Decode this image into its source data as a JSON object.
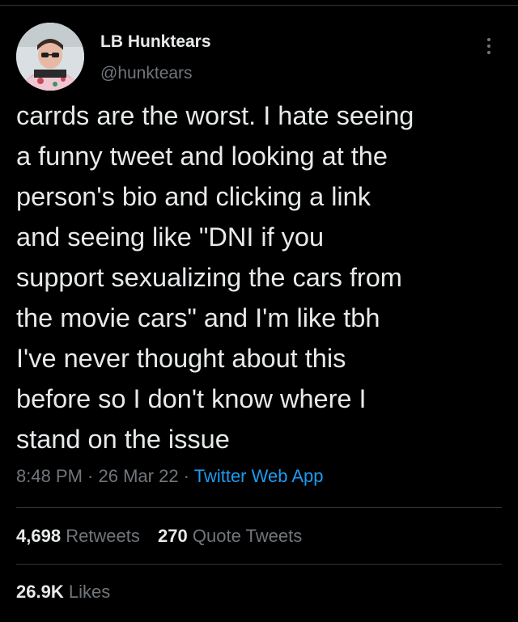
{
  "tweet": {
    "author": {
      "display_name": "LB Hunktears",
      "handle": "@hunktears"
    },
    "text": "carrds are the worst. I hate seeing\na funny tweet and looking at the\nperson's bio and clicking a link\nand seeing like \"DNI if you\nsupport sexualizing the cars from\nthe movie cars\" and I'm like tbh\nI've never thought about this\nbefore so I don't know where I\nstand on the issue",
    "time": "8:48 PM",
    "separator": " · ",
    "date": "26 Mar 22",
    "source": "Twitter Web App",
    "stats": {
      "retweets_count": "4,698",
      "retweets_label": "Retweets",
      "quotes_count": "270",
      "quotes_label": "Quote Tweets",
      "likes_count": "26.9K",
      "likes_label": "Likes"
    }
  },
  "icons": {
    "more": "more-vertical-icon",
    "avatar": "avatar-image"
  },
  "colors": {
    "background": "#000000",
    "text": "#e7e9ea",
    "muted": "#71767b",
    "link": "#1d9bf0",
    "divider": "#2f3336"
  }
}
